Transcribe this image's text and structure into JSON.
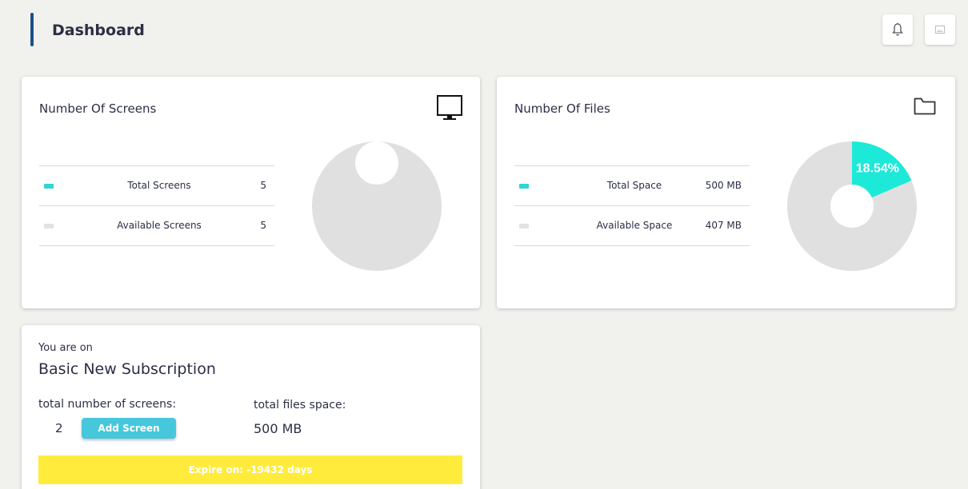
{
  "header": {
    "title": "Dashboard",
    "accent_color": "#1f4f8a",
    "notification_icon": "bell-icon",
    "avatar_icon": "broken-image-icon"
  },
  "screens_card": {
    "title": "Number Of Screens",
    "icon": "monitor-icon",
    "legend": [
      {
        "label": "Total Screens",
        "value": "5",
        "color": "#2fd6d2"
      },
      {
        "label": "Available Screens",
        "value": "5",
        "color": "#e2e2e2"
      }
    ]
  },
  "files_card": {
    "title": "Number Of Files",
    "icon": "folder-icon",
    "legend": [
      {
        "label": "Total Space",
        "value": "500 MB",
        "color": "#2fd6d2"
      },
      {
        "label": "Available Space",
        "value": "407 MB",
        "color": "#e2e2e2"
      }
    ]
  },
  "chart_data": [
    {
      "type": "pie",
      "donut": true,
      "slices": [
        {
          "fraction": 1.0,
          "color": "#e0e0e0"
        }
      ]
    },
    {
      "type": "pie",
      "donut": true,
      "slices": [
        {
          "fraction": 0.1854,
          "color": "#1de9d8",
          "label": "18.54%"
        },
        {
          "fraction": 0.8146,
          "color": "#e0e0e0"
        }
      ]
    }
  ],
  "subscription": {
    "intro": "You are on",
    "plan": "Basic New Subscription",
    "screens_label": "total number of screens:",
    "screens_count": "2",
    "add_screen_label": "Add Screen",
    "space_label": "total files space:",
    "space_value": "500 MB",
    "expire_text": "Expire on: -19432 days",
    "expire_color": "#ffeb3b",
    "button_color": "#46c7dc"
  }
}
